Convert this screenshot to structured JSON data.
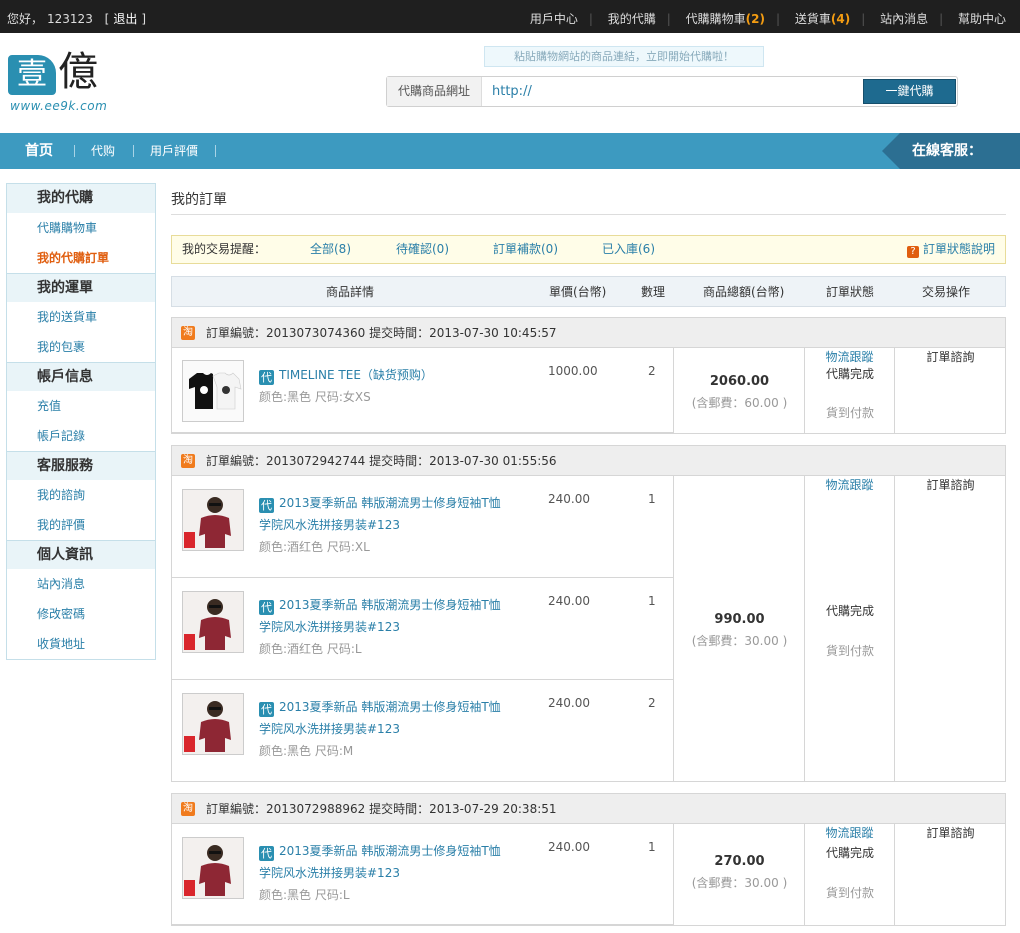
{
  "topbar": {
    "greeting": "您好，",
    "username": "123123",
    "logout_left": "[",
    "logout": "退出",
    "logout_right": "]",
    "links": [
      {
        "label": "用戶中心"
      },
      {
        "label": "我的代購"
      },
      {
        "label": "代購購物車",
        "count": "(2)"
      },
      {
        "label": "送貨車",
        "count": "(4)"
      },
      {
        "label": "站內消息"
      },
      {
        "label": "幫助中心"
      }
    ]
  },
  "logo": {
    "char1": "壹",
    "char2": "億",
    "url": "www.ee9k.com"
  },
  "search": {
    "hint": "粘貼購物網站的商品連結，立即開始代購啦！",
    "label": "代購商品網址",
    "value": "http://",
    "button": "一鍵代購"
  },
  "nav": {
    "home": "首页",
    "items": [
      "代购",
      "用戶評價"
    ],
    "service": "在線客服："
  },
  "sidebar": {
    "groups": [
      {
        "title": "我的代購",
        "items": [
          "代購購物車",
          "我的代購訂單"
        ]
      },
      {
        "title": "我的運單",
        "items": [
          "我的送貨車",
          "我的包裹"
        ]
      },
      {
        "title": "帳戶信息",
        "items": [
          "充值",
          "帳戶記錄"
        ]
      },
      {
        "title": "客服服務",
        "items": [
          "我的諮詢",
          "我的評價"
        ]
      },
      {
        "title": "個人資訊",
        "items": [
          "站內消息",
          "修改密碼",
          "收貨地址"
        ]
      }
    ],
    "active": "我的代購訂單"
  },
  "main": {
    "title": "我的訂單",
    "reminder": {
      "label": "我的交易提醒：",
      "items": [
        "全部(8)",
        "待確認(0)",
        "訂單補款(0)",
        "已入庫(6)"
      ],
      "help_icon": "?",
      "help": "訂單狀態說明"
    },
    "columns": [
      "商品詳情",
      "單價(台幣)",
      "數理",
      "商品總額(台幣)",
      "訂單狀態",
      "交易操作"
    ],
    "orders": [
      {
        "header": "訂單編號：2013073074360   提交時間：2013-07-30 10:45:57",
        "tag": "淘",
        "total": "2060.00",
        "shipping": "(含郵費：60.00 )",
        "status": "代購完成",
        "tracking": "物流跟蹤",
        "payment": "貨到付款",
        "action": "訂單諮詢",
        "items": [
          {
            "badge": "代",
            "name": "TIMELINE TEE（缺货预购）",
            "attr": "颜色:黑色 尺码:女XS",
            "price": "1000.00",
            "qty": "2",
            "image": "tshirt-black-white-icon"
          }
        ]
      },
      {
        "header": "訂單編號：2013072942744   提交時間：2013-07-30 01:55:56",
        "tag": "淘",
        "total": "990.00",
        "shipping": "(含郵費：30.00 )",
        "status": "代購完成",
        "tracking": "物流跟蹤",
        "payment": "貨到付款",
        "action": "訂單諮詢",
        "items": [
          {
            "badge": "代",
            "name": "2013夏季新品 韩版潮流男士修身短袖T恤 学院风水洗拼接男装#123",
            "attr": "颜色:酒红色 尺码:XL",
            "price": "240.00",
            "qty": "1",
            "image": "model-red-shirt-icon"
          },
          {
            "badge": "代",
            "name": "2013夏季新品 韩版潮流男士修身短袖T恤 学院风水洗拼接男装#123",
            "attr": "颜色:酒红色 尺码:L",
            "price": "240.00",
            "qty": "1",
            "image": "model-red-shirt-icon"
          },
          {
            "badge": "代",
            "name": "2013夏季新品 韩版潮流男士修身短袖T恤 学院风水洗拼接男装#123",
            "attr": "颜色:黑色 尺码:M",
            "price": "240.00",
            "qty": "2",
            "image": "model-red-shirt-icon"
          }
        ]
      },
      {
        "header": "訂單編號：2013072988962   提交時間：2013-07-29 20:38:51",
        "tag": "淘",
        "total": "270.00",
        "shipping": "(含郵費：30.00 )",
        "status": "代購完成",
        "tracking": "物流跟蹤",
        "payment": "貨到付款",
        "action": "訂單諮詢",
        "items": [
          {
            "badge": "代",
            "name": "2013夏季新品 韩版潮流男士修身短袖T恤 学院风水洗拼接男装#123",
            "attr": "颜色:黑色 尺码:L",
            "price": "240.00",
            "qty": "1",
            "image": "model-red-shirt-icon"
          }
        ]
      }
    ]
  },
  "colors": {
    "accent": "#3d9ac0",
    "link": "#2a7fa8",
    "active": "#e05e0f",
    "topbar": "#1f1f1f"
  }
}
